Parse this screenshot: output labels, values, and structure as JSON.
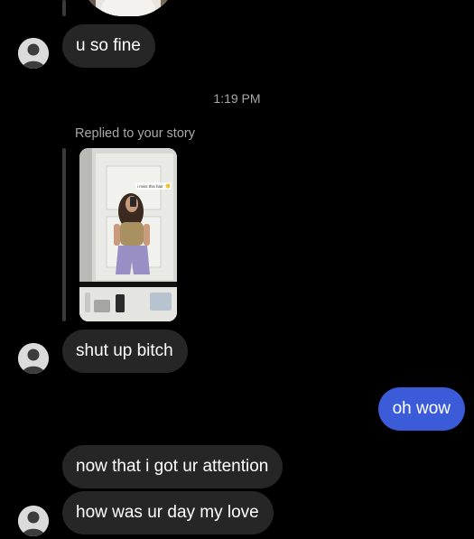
{
  "conversation": {
    "messages": [
      {
        "direction": "incoming",
        "text": "u so fine"
      },
      {
        "direction": "incoming",
        "text": "shut up bitch"
      },
      {
        "direction": "outgoing",
        "text": "oh wow"
      },
      {
        "direction": "incoming",
        "text": "now that i got ur attention"
      },
      {
        "direction": "incoming",
        "text": "how was ur day my love"
      }
    ],
    "timestamp": "1:19 PM",
    "reply_label": "Replied to your story",
    "story_caption": "i miss this hair"
  },
  "colors": {
    "background": "#000000",
    "incoming_bubble": "#262626",
    "outgoing_bubble": "#3b5bd9",
    "secondary_text": "#a8a8a8"
  },
  "icons": {
    "avatar": "default-user-avatar-icon"
  }
}
